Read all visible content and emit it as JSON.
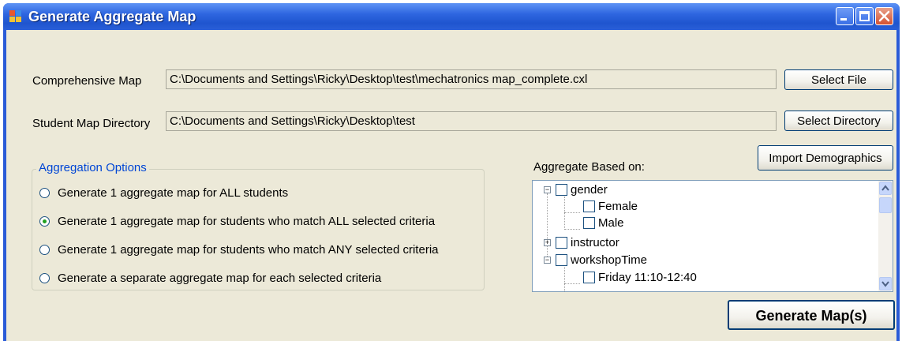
{
  "window": {
    "title": "Generate Aggregate Map",
    "controls": {
      "minimize": "minimize-icon",
      "maximize": "maximize-icon",
      "close": "close-icon"
    }
  },
  "comprehensive_map": {
    "label": "Comprehensive Map",
    "value": "C:\\Documents and Settings\\Ricky\\Desktop\\test\\mechatronics map_complete.cxl",
    "button": "Select File"
  },
  "student_map_directory": {
    "label": "Student Map Directory",
    "value": "C:\\Documents and Settings\\Ricky\\Desktop\\test",
    "button": "Select Directory"
  },
  "aggregation_options": {
    "title": "Aggregation Options",
    "options": [
      {
        "label": "Generate 1 aggregate map for ALL students",
        "selected": false
      },
      {
        "label": "Generate 1 aggregate map for students who match ALL selected criteria",
        "selected": true
      },
      {
        "label": "Generate 1 aggregate map for students who match ANY selected criteria",
        "selected": false
      },
      {
        "label": "Generate a separate aggregate map for each selected criteria",
        "selected": false
      }
    ]
  },
  "aggregate_based_on": {
    "label": "Aggregate Based on:",
    "import_button": "Import Demographics",
    "tree": [
      {
        "label": "gender",
        "level": 0,
        "expander": "−"
      },
      {
        "label": "Female",
        "level": 1
      },
      {
        "label": "Male",
        "level": 1
      },
      {
        "label": "instructor",
        "level": 0,
        "expander": "+"
      },
      {
        "label": "workshopTime",
        "level": 0,
        "expander": "−"
      },
      {
        "label": "Friday 11:10-12:40",
        "level": 1
      }
    ]
  },
  "generate_button": "Generate Map(s)",
  "colors": {
    "titlebar": "#2e66e0",
    "client_background": "#ece9d8",
    "group_title": "#0046d5",
    "selected_radio": "#21a121",
    "close_button": "#d55232"
  }
}
